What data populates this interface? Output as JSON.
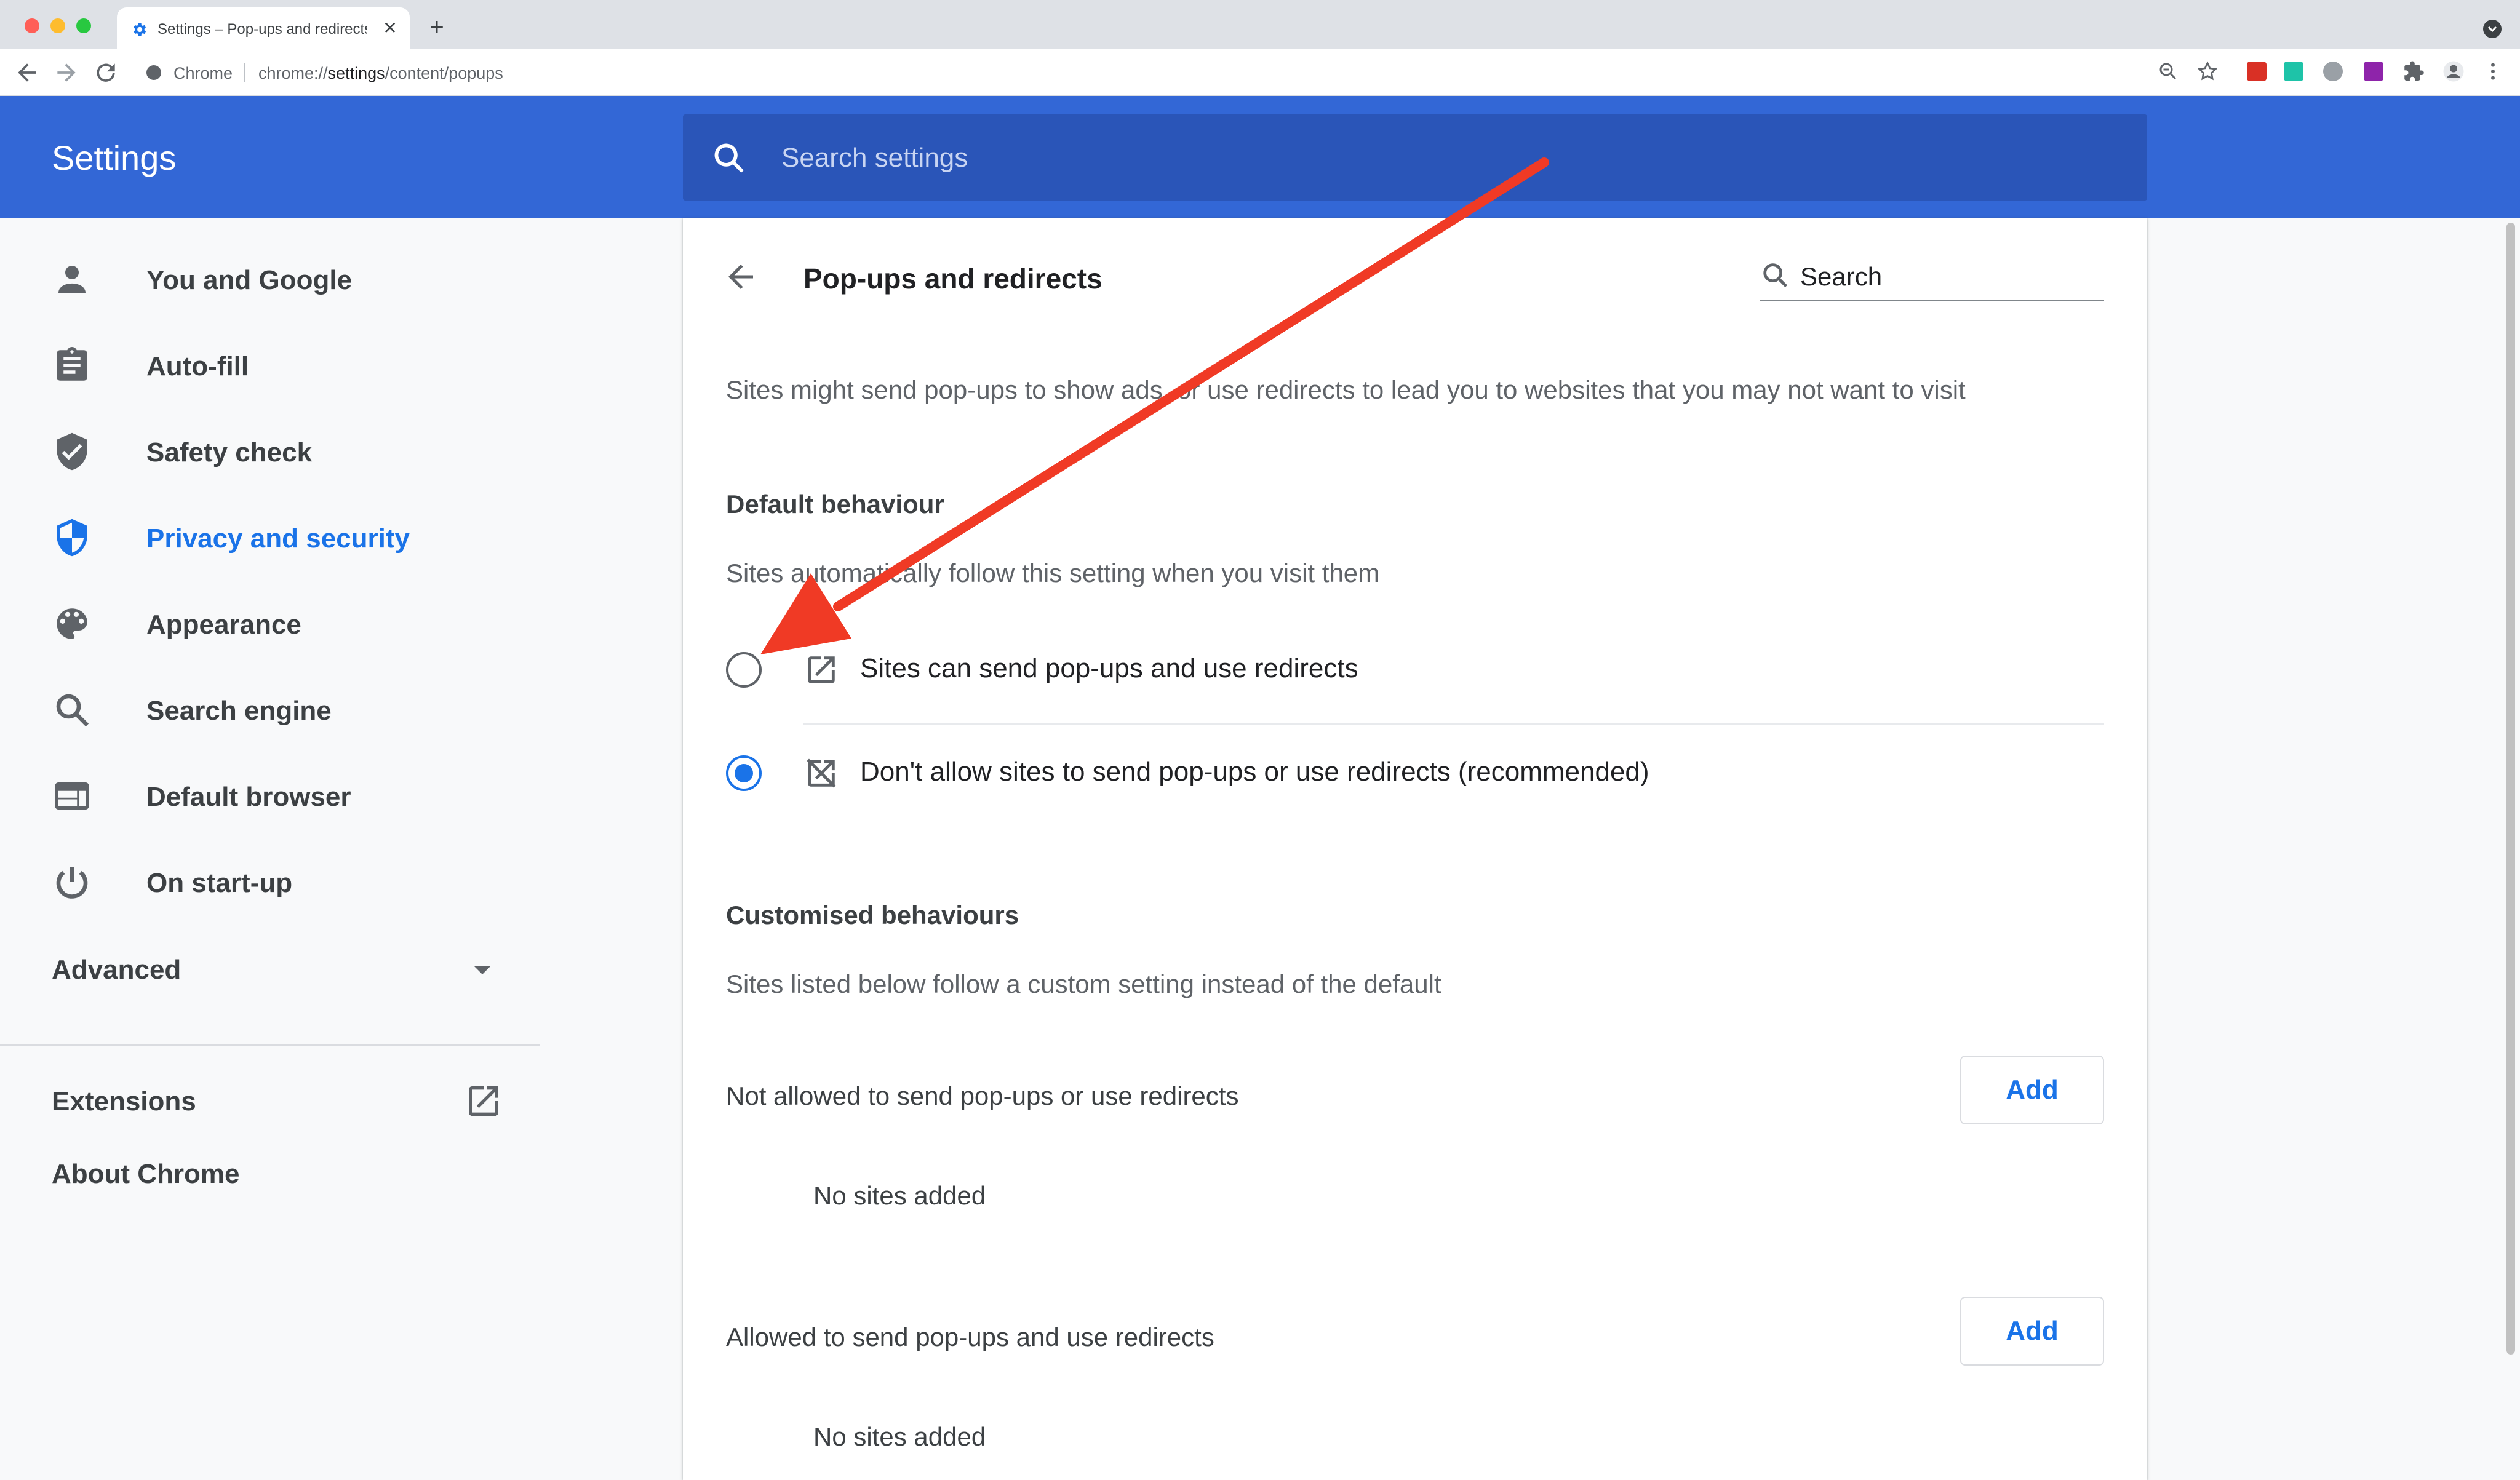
{
  "browser": {
    "tab_title": "Settings – Pop-ups and redirects",
    "tab_close": "✕",
    "new_tab": "+",
    "omnibox": {
      "site_label": "Chrome",
      "url_scheme": "chrome://",
      "url_host": "settings",
      "url_path": "/content/popups"
    },
    "colors": {
      "close": "#ff5f57",
      "minimize": "#febc2e",
      "maximize": "#28c840"
    }
  },
  "header": {
    "title": "Settings",
    "search_placeholder": "Search settings"
  },
  "sidebar": {
    "items": [
      {
        "label": "You and Google",
        "icon": "person-icon"
      },
      {
        "label": "Auto-fill",
        "icon": "clipboard-icon"
      },
      {
        "label": "Safety check",
        "icon": "shield-check-icon"
      },
      {
        "label": "Privacy and security",
        "icon": "shield-icon",
        "active": true
      },
      {
        "label": "Appearance",
        "icon": "palette-icon"
      },
      {
        "label": "Search engine",
        "icon": "search-icon"
      },
      {
        "label": "Default browser",
        "icon": "browser-icon"
      },
      {
        "label": "On start-up",
        "icon": "power-icon"
      }
    ],
    "advanced_label": "Advanced",
    "extensions_label": "Extensions",
    "about_label": "About Chrome"
  },
  "page": {
    "title": "Pop-ups and redirects",
    "search_placeholder": "Search",
    "description": "Sites might send pop-ups to show ads, or use redirects to lead you to websites that you may not want to visit",
    "default_behaviour": {
      "heading": "Default behaviour",
      "subtext": "Sites automatically follow this setting when you visit them",
      "options": [
        {
          "label": "Sites can send pop-ups and use redirects",
          "icon": "open-in-new-icon",
          "selected": false
        },
        {
          "label": "Don't allow sites to send pop-ups or use redirects (recommended)",
          "icon": "popup-blocked-icon",
          "selected": true
        }
      ]
    },
    "customised_behaviours": {
      "heading": "Customised behaviours",
      "subtext": "Sites listed below follow a custom setting instead of the default",
      "lists": [
        {
          "label": "Not allowed to send pop-ups or use redirects",
          "button": "Add",
          "empty_text": "No sites added"
        },
        {
          "label": "Allowed to send pop-ups and use redirects",
          "button": "Add",
          "empty_text": "No sites added"
        }
      ]
    }
  },
  "colors": {
    "header": "#3367d6",
    "accent": "#1a73e8",
    "annotation_arrow": "#f03a25"
  }
}
